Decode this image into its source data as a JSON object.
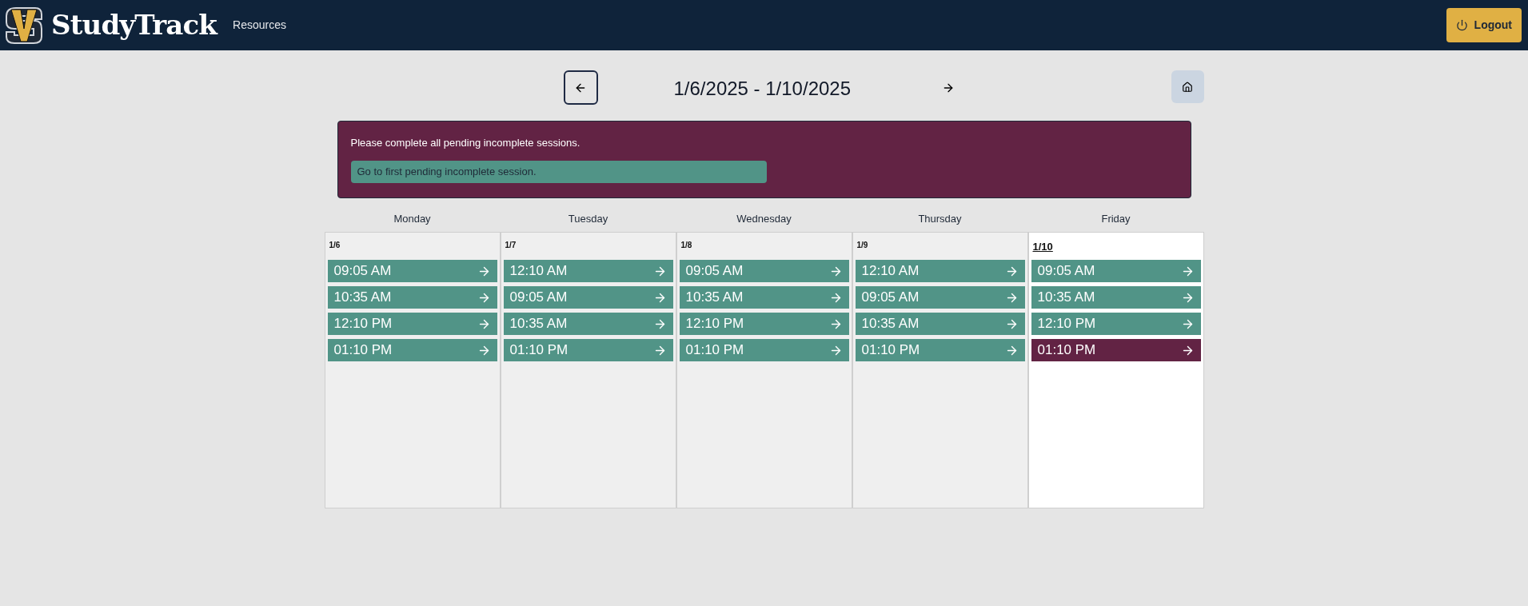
{
  "header": {
    "brand": "StudyTrack",
    "nav_link": "Resources",
    "logout": "Logout"
  },
  "week_nav": {
    "range": "1/6/2025 - 1/10/2025"
  },
  "alert": {
    "message": "Please complete all pending incomplete sessions.",
    "action": "Go to first pending incomplete session."
  },
  "days": [
    {
      "name": "Monday",
      "date": "1/6",
      "today": false,
      "sessions": [
        {
          "time": "09:05 AM",
          "pending": false
        },
        {
          "time": "10:35 AM",
          "pending": false
        },
        {
          "time": "12:10 PM",
          "pending": false
        },
        {
          "time": "01:10 PM",
          "pending": false
        }
      ]
    },
    {
      "name": "Tuesday",
      "date": "1/7",
      "today": false,
      "sessions": [
        {
          "time": "12:10 AM",
          "pending": false
        },
        {
          "time": "09:05 AM",
          "pending": false
        },
        {
          "time": "10:35 AM",
          "pending": false
        },
        {
          "time": "01:10 PM",
          "pending": false
        }
      ]
    },
    {
      "name": "Wednesday",
      "date": "1/8",
      "today": false,
      "sessions": [
        {
          "time": "09:05 AM",
          "pending": false
        },
        {
          "time": "10:35 AM",
          "pending": false
        },
        {
          "time": "12:10 PM",
          "pending": false
        },
        {
          "time": "01:10 PM",
          "pending": false
        }
      ]
    },
    {
      "name": "Thursday",
      "date": "1/9",
      "today": false,
      "sessions": [
        {
          "time": "12:10 AM",
          "pending": false
        },
        {
          "time": "09:05 AM",
          "pending": false
        },
        {
          "time": "10:35 AM",
          "pending": false
        },
        {
          "time": "01:10 PM",
          "pending": false
        }
      ]
    },
    {
      "name": "Friday",
      "date": "1/10",
      "today": true,
      "sessions": [
        {
          "time": "09:05 AM",
          "pending": false
        },
        {
          "time": "10:35 AM",
          "pending": false
        },
        {
          "time": "12:10 PM",
          "pending": false
        },
        {
          "time": "01:10 PM",
          "pending": true
        }
      ]
    }
  ]
}
